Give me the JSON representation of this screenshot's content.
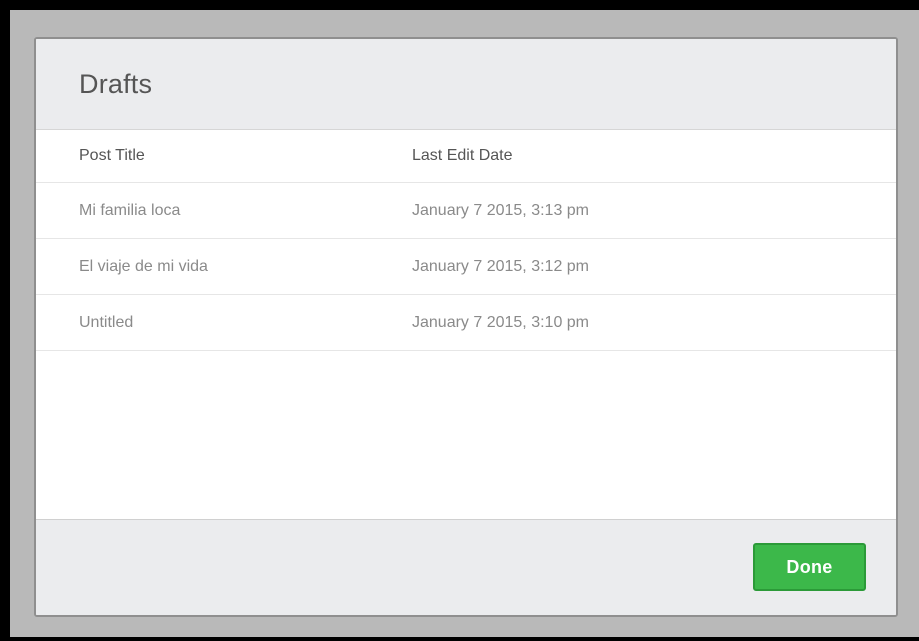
{
  "dialog": {
    "title": "Drafts"
  },
  "table": {
    "columns": [
      "Post Title",
      "Last Edit Date"
    ],
    "rows": [
      {
        "title": "Mi familia loca",
        "date": "January 7 2015, 3:13 pm"
      },
      {
        "title": "El viaje de mi vida",
        "date": "January 7 2015, 3:12 pm"
      },
      {
        "title": "Untitled",
        "date": "January 7 2015, 3:10 pm"
      }
    ]
  },
  "footer": {
    "done_label": "Done"
  },
  "colors": {
    "accent": "#3cb84a",
    "header_bg": "#ebecee",
    "backdrop": "#000000"
  }
}
